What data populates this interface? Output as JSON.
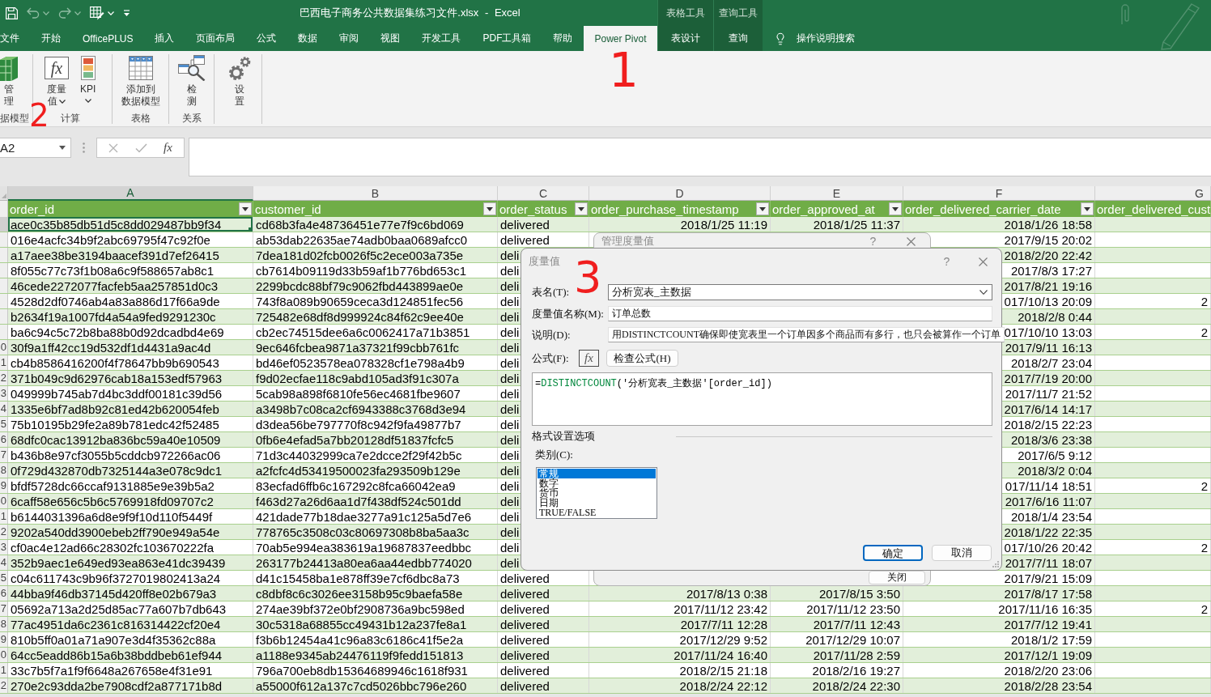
{
  "title_bar": {
    "title": "巴西电子商务公共数据集练习文件.xlsx - Excel",
    "quick_access": [
      {
        "kind": "save",
        "disabled": false
      },
      {
        "kind": "undo",
        "disabled": true
      },
      {
        "kind": "redo",
        "disabled": true
      },
      {
        "kind": "form",
        "disabled": false
      },
      {
        "kind": "customize",
        "disabled": false
      }
    ]
  },
  "tabs": [
    {
      "label": "文件",
      "selected": false
    },
    {
      "label": "开始",
      "selected": false
    },
    {
      "label": "OfficePLUS",
      "selected": false
    },
    {
      "label": "插入",
      "selected": false
    },
    {
      "label": "页面布局",
      "selected": false
    },
    {
      "label": "公式",
      "selected": false
    },
    {
      "label": "数据",
      "selected": false
    },
    {
      "label": "审阅",
      "selected": false
    },
    {
      "label": "视图",
      "selected": false
    },
    {
      "label": "开发工具",
      "selected": false
    },
    {
      "label": "PDF工具箱",
      "selected": false
    },
    {
      "label": "帮助",
      "selected": false
    },
    {
      "label": "Power Pivot",
      "selected": true
    }
  ],
  "context_groups": [
    {
      "label": "表格工具",
      "tab": {
        "label": "表设计",
        "selected": false
      }
    },
    {
      "label": "查询工具",
      "tab": {
        "label": "查询",
        "selected": false
      }
    }
  ],
  "tell_me": {
    "label": "操作说明搜索"
  },
  "ribbon": {
    "groups": [
      {
        "label": "据模型",
        "buttons": [
          {
            "kind": "manage",
            "label": "管理",
            "has_menu": false
          }
        ]
      },
      {
        "label": "计算",
        "buttons": [
          {
            "kind": "measure",
            "icon_text": "fx",
            "label": "度量值",
            "has_menu": true
          },
          {
            "kind": "kpi",
            "label": "KPI",
            "has_menu": true
          }
        ]
      },
      {
        "label": "表格",
        "buttons": [
          {
            "kind": "add_to_model",
            "label": "添加到数据模型",
            "has_menu": false
          }
        ]
      },
      {
        "label": "关系",
        "buttons": [
          {
            "kind": "detect",
            "label": "检测",
            "has_menu": false
          }
        ]
      },
      {
        "buttons": [
          {
            "kind": "settings",
            "label": "设置",
            "has_menu": false
          }
        ]
      }
    ]
  },
  "formula_bar": {
    "name_box": "A2",
    "buttons": [
      {
        "kind": "cancel",
        "disabled": true
      },
      {
        "kind": "enter",
        "disabled": true
      },
      {
        "kind": "function",
        "label": "fx",
        "disabled": false
      }
    ]
  },
  "sheet": {
    "columns": [
      {
        "letter": "A",
        "header": "order_id",
        "kind": "text",
        "has_filter": true,
        "selected": true
      },
      {
        "letter": "B",
        "header": "customer_id",
        "kind": "text",
        "has_filter": true,
        "selected": false
      },
      {
        "letter": "C",
        "header": "order_status",
        "kind": "text",
        "has_filter": true,
        "selected": false
      },
      {
        "letter": "D",
        "header": "order_purchase_timestamp",
        "kind": "date",
        "has_filter": true,
        "selected": false
      },
      {
        "letter": "E",
        "header": "order_approved_at",
        "kind": "date",
        "has_filter": true,
        "selected": false
      },
      {
        "letter": "F",
        "header": "order_delivered_carrier_date",
        "kind": "date",
        "has_filter": true,
        "selected": false
      },
      {
        "letter": "G",
        "header": "order_delivered_cust",
        "kind": "date",
        "has_filter": false,
        "selected": false
      }
    ],
    "rows": [
      {
        "selected": true,
        "cells": [
          "ace0c35b85db51d5c8dd029487bb9f34",
          "cd68b3fa4e48736451e77e7f9c6bd069",
          "delivered",
          "2018/1/25 11:19",
          "2018/1/25 11:37",
          "2018/1/26 18:58"
        ]
      },
      {
        "selected": false,
        "cells": [
          "016e4acfc34b9f2abc69795f47c92f0e",
          "ab53dab22635ae74adb0baa0689afcc0",
          "delivered",
          null,
          null,
          "2017/9/15 20:02"
        ]
      },
      {
        "selected": false,
        "cells": [
          "a17aee38be3194baacef391d7ef26415",
          "7dea181d02fcb0026f5c2ece003a735e",
          "deli",
          null,
          null,
          "2018/2/20 22:42"
        ]
      },
      {
        "selected": false,
        "cells": [
          "8f055c77c73f1b08a6c9f588657ab8c1",
          "cb7614b09119d33b59af1b776bd653c1",
          "deli",
          null,
          null,
          "2017/8/3 17:27"
        ]
      },
      {
        "selected": false,
        "cells": [
          "46cede2272077facfeb5aa257851d0c3",
          "2299bcdc88bf79c9062fbd443899ae0e",
          "deli",
          null,
          null,
          "2017/8/21 19:16"
        ]
      },
      {
        "selected": false,
        "cells": [
          "4528d2df0746ab4a83a886d17f66a9de",
          "743f8a089b90659ceca3d124851fec56",
          "deli",
          null,
          null,
          "017/10/13 20:09",
          "2"
        ]
      },
      {
        "selected": false,
        "cells": [
          "b2634f19a1007fd4a54a9fed9291230c",
          "725482e68df8d999924c84f62c9ee40e",
          "deli",
          null,
          null,
          "2018/2/8 0:44"
        ]
      },
      {
        "selected": false,
        "cells": [
          "ba6c94c5c72b8ba88b0d92dcadbd4e69",
          "cb2ec74515dee6a6c0062417a71b3851",
          "deli",
          null,
          null,
          "017/10/10 13:03",
          "2"
        ]
      },
      {
        "selected": false,
        "row_number": "0",
        "cells": [
          "30f9a1ff42cc19d532df1d4431a9ac4d",
          "9ec646fcbea9871a37321f99cbb761fc",
          "deli",
          null,
          null,
          "2017/9/11 16:13"
        ]
      },
      {
        "selected": false,
        "row_number": "1",
        "cells": [
          "cb4b8586416200f4f78647bb9b690543",
          "bd46ef0523578ea078328cf1e798a4b9",
          "deli",
          null,
          null,
          "2018/2/7 23:04"
        ]
      },
      {
        "selected": false,
        "row_number": "2",
        "cells": [
          "371b049c9d62976cab18a153edf57963",
          "f9d02ecfae118c9abd105ad3f91c307a",
          "deli",
          null,
          null,
          "2017/7/19 20:00"
        ]
      },
      {
        "selected": false,
        "row_number": "3",
        "cells": [
          "049999b745ab7d4bc3ddf00181c39d56",
          "5cab98a898f6810fe56ec4681fbe9607",
          "deli",
          null,
          null,
          "2017/11/7 21:52"
        ]
      },
      {
        "selected": false,
        "row_number": "4",
        "cells": [
          "1335e6bf7ad8b92c81ed42b620054feb",
          "a3498b7c08ca2cf6943388c3768d3e94",
          "deli",
          null,
          null,
          "2017/6/14 14:17"
        ]
      },
      {
        "selected": false,
        "row_number": "5",
        "cells": [
          "75b10195b29fe2a89b781edc42f52485",
          "d3dea56be797770f8c942f9fa49877b7",
          "deli",
          null,
          null,
          "2018/2/15 22:23"
        ]
      },
      {
        "selected": false,
        "row_number": "6",
        "cells": [
          "68dfc0cac13912ba836bc59a40e10509",
          "0fb6e4efad5a7bb20128df51837fcfc5",
          "deli",
          null,
          null,
          "2018/3/6 23:38"
        ]
      },
      {
        "selected": false,
        "row_number": "7",
        "cells": [
          "b436b8e97cf3055b5cddcb972266ac06",
          "71d3c44032999ca7e2dcce2f29f42b5c",
          "deli",
          null,
          null,
          "2017/6/5 9:12"
        ]
      },
      {
        "selected": false,
        "row_number": "8",
        "cells": [
          "0f729d432870db7325144a3e078c9dc1",
          "a2fcfc4d53419500023fa293509b129e",
          "deli",
          null,
          null,
          "2018/3/2 0:04"
        ]
      },
      {
        "selected": false,
        "row_number": "9",
        "cells": [
          "bfdf5728dc66ccaf9131885e9e39b5a2",
          "83ecfad6ffb6c167292c8fca66042ea9",
          "deli",
          null,
          null,
          "017/11/14 18:51",
          "2"
        ]
      },
      {
        "selected": false,
        "row_number": "0",
        "cells": [
          "6caff58e656c5b6c5769918fd09707c2",
          "f463d27a26d6aa1d7f438df524c501dd",
          "deli",
          null,
          null,
          "2017/6/16 11:07"
        ]
      },
      {
        "selected": false,
        "row_number": "1",
        "cells": [
          "b6144031396a6d8e9f9f10d110f5449f",
          "421dade77b18dae3277a91c125a5d7e6",
          "deli",
          null,
          null,
          "2018/1/4 23:54"
        ]
      },
      {
        "selected": false,
        "row_number": "2",
        "cells": [
          "9202a540dd3900ebeb2ff790e949a54e",
          "778765c3508c03c80697308b8ba5aa3c",
          "deli",
          null,
          null,
          "2018/1/22 22:35"
        ]
      },
      {
        "selected": false,
        "row_number": "3",
        "cells": [
          "cf0ac4e12ad66c28302fc103670222fa",
          "70ab5e994ea383619a19687837eedbbc",
          "deli",
          null,
          null,
          "017/10/26 20:42",
          "2"
        ]
      },
      {
        "selected": false,
        "row_number": "4",
        "cells": [
          "352b9aec1e649ed93ea863e41dc39439",
          "263177b24413a80ea6aa44edbb774020",
          "deli",
          null,
          null,
          "2017/7/11 18:07"
        ]
      },
      {
        "selected": false,
        "row_number": "5",
        "cells": [
          "c04c611743c9b96f3727019802413a24",
          "d41c15458ba1e878ff39e7cf6dbc8a73",
          "delivered",
          null,
          null,
          "2017/9/21 15:09"
        ]
      },
      {
        "selected": false,
        "row_number": "6",
        "cells": [
          "44bba9f46db37145d420ff8e02b679a3",
          "c8dbf8c6c3026ee3158b95c9baefa58e",
          "delivered",
          "2017/8/13 0:38",
          "2017/8/15 3:50",
          "2017/8/17 17:58"
        ]
      },
      {
        "selected": false,
        "row_number": "7",
        "cells": [
          "05692a713a2d25d85ac77a607b7db643",
          "274ae39bf372e0bf2908736a9bc598ed",
          "delivered",
          "2017/11/12 23:42",
          "2017/11/12 23:50",
          "2017/11/16 16:35",
          "2"
        ]
      },
      {
        "selected": false,
        "row_number": "8",
        "cells": [
          "77ac4951da6c2361c816314422cf20e4",
          "30c5318a68855cc49431b12a237fe8a1",
          "delivered",
          "2017/7/11 12:28",
          "2017/7/11 12:43",
          "2017/7/12 19:41"
        ]
      },
      {
        "selected": false,
        "row_number": "9",
        "cells": [
          "810b5ff0a01a71a907e3d4f35362c88a",
          "f3b6b12454a41c96a83c6186c41f5e2a",
          "delivered",
          "2017/12/29 9:52",
          "2017/12/29 10:07",
          "2018/1/2 17:59"
        ]
      },
      {
        "selected": false,
        "row_number": "0",
        "cells": [
          "64cc5eadd86b15a6b38bddbeb61ef944",
          "a1188e9345ab24476119f9fedd151813",
          "delivered",
          "2017/11/24 16:40",
          "2017/11/28 2:59",
          "2017/12/1 19:09"
        ]
      },
      {
        "selected": false,
        "row_number": "1",
        "cells": [
          "33c7b5f7a1f9f6648a267658e4f31e91",
          "796a700eb8db15364689946c1618f931",
          "delivered",
          "2018/2/15 21:18",
          "2018/2/16 19:27",
          "2018/2/20 23:06"
        ]
      },
      {
        "selected": false,
        "row_number": "2",
        "cells": [
          "270e2c93dda2be7908cdf2a877171b8d",
          "a55000f612a137c7cd5026bbc796e260",
          "delivered",
          "2018/2/24 22:12",
          "2018/2/24 22:30",
          "2018/2/28 23:54"
        ]
      }
    ]
  },
  "dialogs": {
    "manage_measures": {
      "title": "管理度量值",
      "help": "?",
      "close_button": "关闭"
    },
    "measure": {
      "title": "度量值",
      "help": "?",
      "table_name": {
        "label": "表名(T):",
        "value": "分析宽表_主数据"
      },
      "measure_name": {
        "label": "度量值名称(M):",
        "value": "订单总数"
      },
      "description": {
        "label": "说明(D):",
        "value": "用DISTINCTCOUNT确保即使宽表里一个订单因多个商品而有多行，也只会被算作一个订单"
      },
      "formula": {
        "label": "公式(F):",
        "fx_button": "fx",
        "check_button": "检查公式(H)",
        "tokens": [
          {
            "kind": "operator",
            "text": "="
          },
          {
            "kind": "function",
            "text": "DISTINCTCOUNT"
          },
          {
            "kind": "plain",
            "text": "('分析宽表_主数据'[order_id])"
          }
        ]
      },
      "format_options": {
        "heading": "格式设置选项",
        "category_label": "类别(C):",
        "categories": [
          {
            "label": "常规",
            "selected": true
          },
          {
            "label": "数字",
            "selected": false
          },
          {
            "label": "货币",
            "selected": false
          },
          {
            "label": "日期",
            "selected": false
          },
          {
            "label": "TRUE/FALSE",
            "selected": false
          }
        ]
      },
      "buttons": [
        {
          "label": "确定",
          "default": true
        },
        {
          "label": "取消",
          "default": false
        }
      ]
    }
  },
  "annotations": [
    {
      "text": "1"
    },
    {
      "text": "2"
    },
    {
      "text": "3"
    }
  ]
}
